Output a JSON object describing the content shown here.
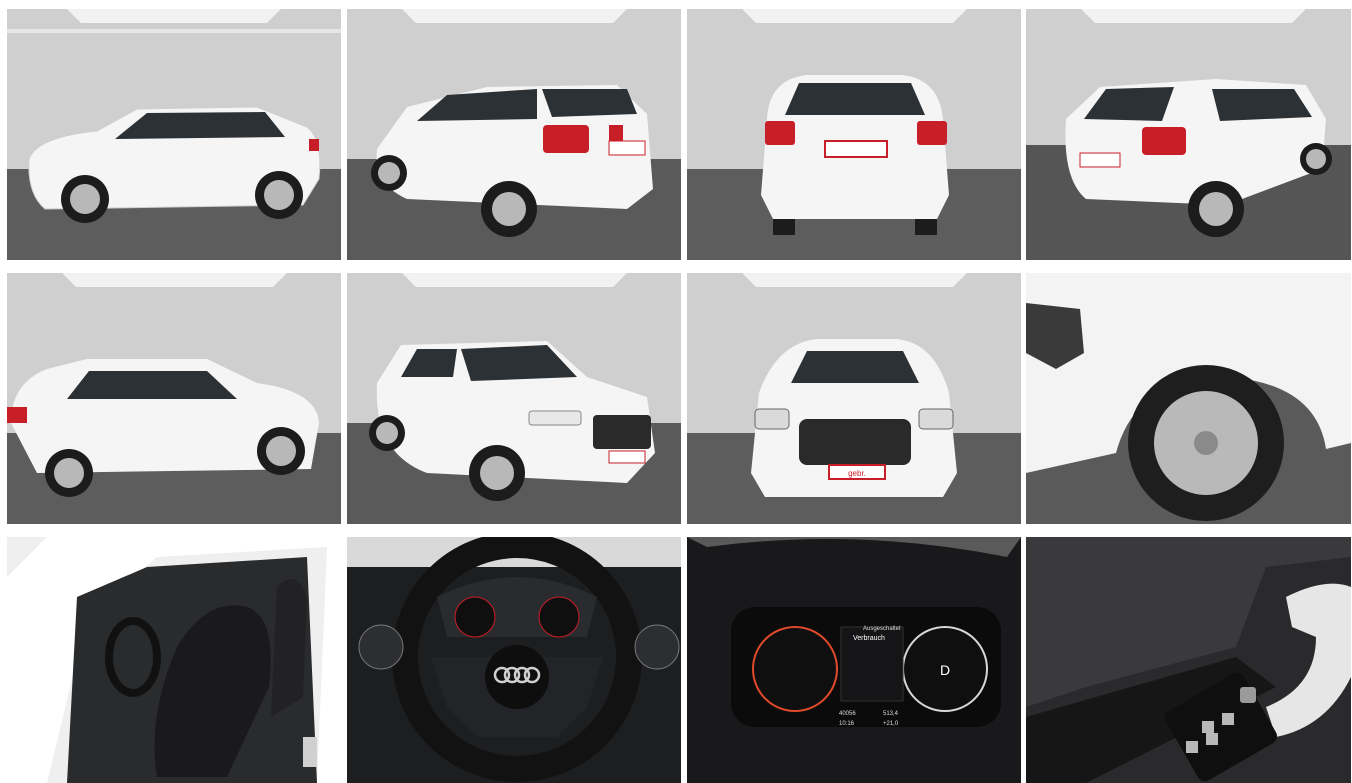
{
  "gallery": {
    "photos": [
      {
        "view": "side-left",
        "label": "Exterior side view left"
      },
      {
        "view": "rear-three-quarter",
        "label": "Exterior rear three-quarter left"
      },
      {
        "view": "rear",
        "label": "Exterior rear"
      },
      {
        "view": "rear-three-quarter-right",
        "label": "Exterior rear three-quarter right"
      },
      {
        "view": "side-right",
        "label": "Exterior side view right"
      },
      {
        "view": "front-three-quarter",
        "label": "Exterior front three-quarter"
      },
      {
        "view": "front",
        "label": "Exterior front"
      },
      {
        "view": "wheel-detail",
        "label": "Wheel arch detail"
      },
      {
        "view": "interior-seats",
        "label": "Interior front seats"
      },
      {
        "view": "steering-wheel",
        "label": "Steering wheel"
      },
      {
        "view": "instrument-cluster",
        "label": "Virtual cockpit"
      },
      {
        "view": "door-controls",
        "label": "Door window controls"
      }
    ],
    "cluster_texts": {
      "top_right": "Ausgeschaltet",
      "menu_title": "Verbrauch",
      "gear": "D",
      "odometer": "40056",
      "range": "513,4",
      "time": "10:16",
      "temp": "+21,0"
    },
    "plate_text": "gebr."
  },
  "colors": {
    "studio_wall": "#cfcfcf",
    "studio_floor": "#5f5f5f",
    "car_white": "#f4f4f4",
    "tail_red": "#c81e28",
    "window": "#2e3338",
    "interior_dark": "#1e1e20"
  }
}
